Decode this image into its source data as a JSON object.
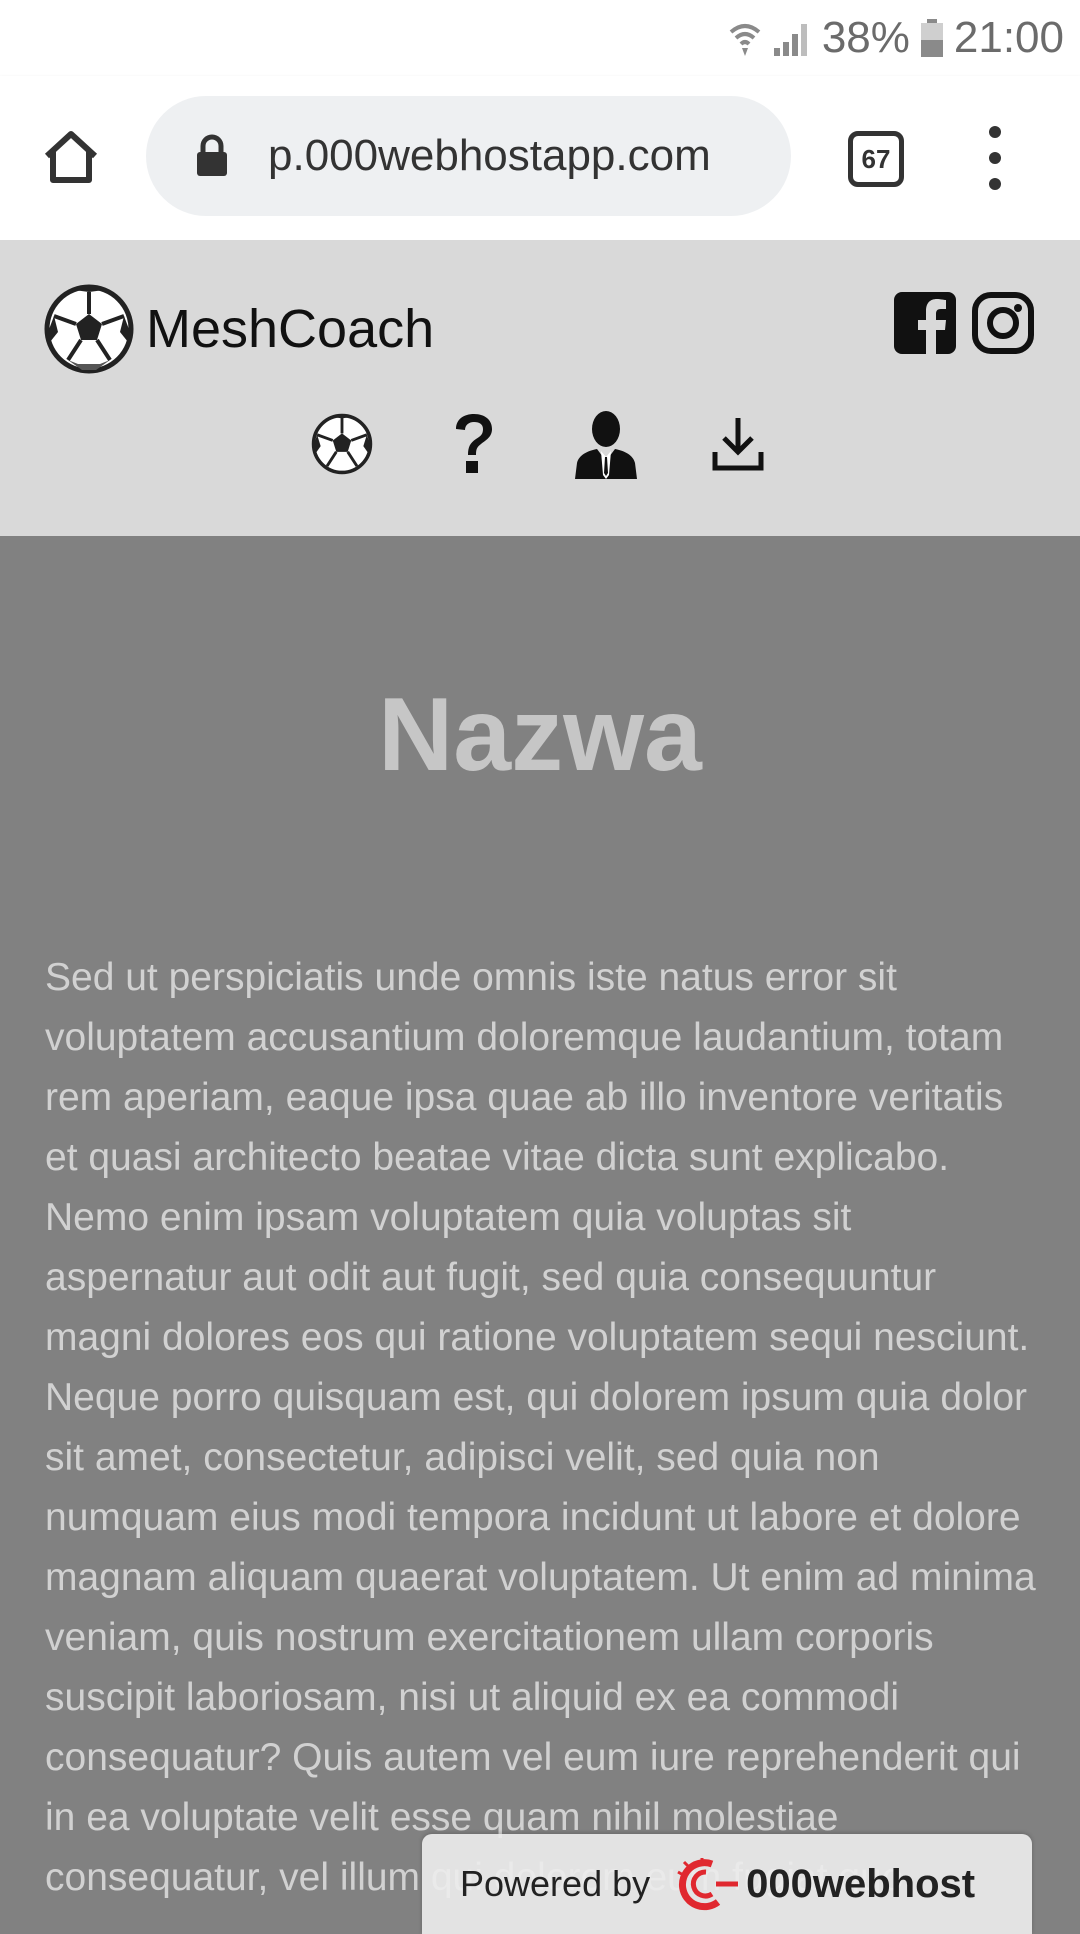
{
  "status_bar": {
    "battery": "38%",
    "time": "21:00"
  },
  "browser": {
    "url": "p.000webhostapp.com",
    "tab_count": "67"
  },
  "site": {
    "brand": "MeshCoach",
    "nav": [
      "football-icon",
      "help-icon",
      "coach-icon",
      "download-icon"
    ],
    "social": [
      "facebook-icon",
      "instagram-icon"
    ]
  },
  "main": {
    "title": "Nazwa",
    "body": "Sed ut perspiciatis unde omnis iste natus error sit voluptatem accusantium doloremque laudantium, totam rem aperiam, eaque ipsa quae ab illo inventore veritatis et quasi architecto beatae vitae dicta sunt explicabo. Nemo enim ipsam voluptatem quia voluptas sit aspernatur aut odit aut fugit, sed quia consequuntur magni dolores eos qui ratione voluptatem sequi nesciunt. Neque porro quisquam est, qui dolorem ipsum quia dolor sit amet, consectetur, adipisci velit, sed quia non numquam eius modi tempora incidunt ut labore et dolore magnam aliquam quaerat voluptatem. Ut enim ad minima veniam, quis nostrum exercitationem ullam corporis suscipit laboriosam, nisi ut aliquid ex ea commodi consequatur? Quis autem vel eum iure reprehenderit qui in ea voluptate velit esse quam nihil molestiae consequatur, vel illum qui dolorem eum fugiat quo voluptas nulla pariatur?"
  },
  "badge": {
    "label": "Powered by",
    "brand": "000webhost"
  },
  "colors": {
    "header_bg": "#d9d9d9",
    "main_bg": "#818181",
    "title": "#c6c6c6",
    "body_text": "#d1d1d1"
  }
}
